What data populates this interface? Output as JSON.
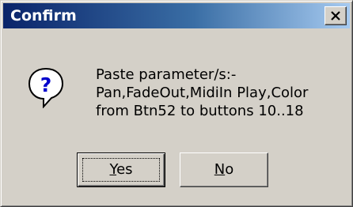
{
  "window": {
    "title": "Confirm",
    "close_glyph": "close-icon"
  },
  "message": {
    "icon": "question-icon",
    "lines": [
      "Paste parameter/s:-",
      "Pan,FadeOut,MidiIn Play,Color",
      "from Btn52 to buttons 10..18"
    ]
  },
  "buttons": {
    "yes": {
      "mnemonic": "Y",
      "rest": "es"
    },
    "no": {
      "mnemonic": "N",
      "rest": "o"
    }
  },
  "colors": {
    "title_gradient_start": "#0a246a",
    "title_gradient_end": "#a6caf0",
    "face": "#d4d0c8",
    "icon_blue": "#0000cc"
  }
}
